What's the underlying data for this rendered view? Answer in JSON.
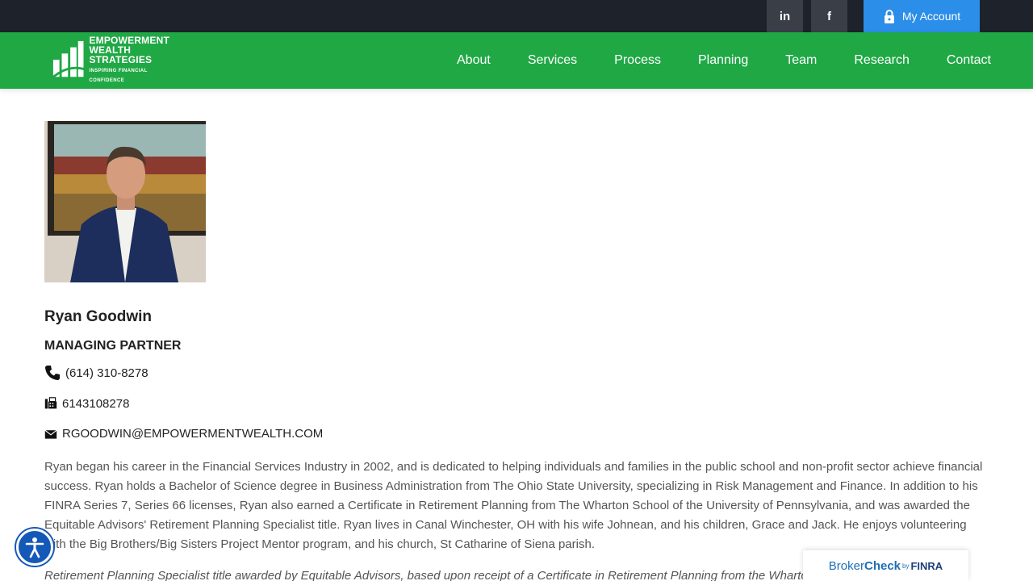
{
  "topbar": {
    "linkedin_label": "in",
    "facebook_label": "f",
    "account_label": "My Account"
  },
  "logo": {
    "line1": "EMPOWERMENT",
    "line2": "WEALTH",
    "line3": "STRATEGIES",
    "tagline": "INSPIRING FINANCIAL CONFIDENCE"
  },
  "nav": {
    "items": [
      "About",
      "Services",
      "Process",
      "Planning",
      "Team",
      "Research",
      "Contact"
    ]
  },
  "profile": {
    "name": "Ryan Goodwin",
    "role": "MANAGING PARTNER",
    "phone": "(614) 310-8278",
    "fax": "6143108278",
    "email": "RGOODWIN@EMPOWERMENTWEALTH.COM",
    "bio": "Ryan began his career in the Financial Services Industry in 2002, and is dedicated to helping individuals and families in the public school and non-profit sector achieve financial success. Ryan holds a Bachelor of Science degree in Business Administration from The Ohio State University, specializing in Risk Management and Finance. In addition to his FINRA Series 7, Series 66 licenses, Ryan also earned a Certificate in Retirement Planning from The Wharton School of the University of Pennsylvania, and was awarded the Equitable Advisors' Retirement Planning Specialist title. Ryan lives in Canal Winchester, OH with his wife Johnean, and his children, Grace and Jack. He enjoys volunteering with the Big Brothers/Big Sisters Project Mentor program, and his church, St Catharine of Siena parish.",
    "disclaimer": "Retirement Planning Specialist title awarded by Equitable Advisors, based upon receipt of a Certificate in Retirement Planning from the Wharton School of the University of"
  },
  "brokercheck": {
    "broker": "Broker",
    "check": "Check",
    "by": "by",
    "finra": "FINRA"
  },
  "colors": {
    "topbar": "#1e222b",
    "nav_green": "#20a845",
    "account_blue": "#2b8ee8",
    "accessibility_blue": "#1458b8"
  },
  "icons": [
    "linkedin-icon",
    "facebook-icon",
    "lock-icon",
    "phone-icon",
    "fax-icon",
    "envelope-icon",
    "accessibility-icon"
  ]
}
